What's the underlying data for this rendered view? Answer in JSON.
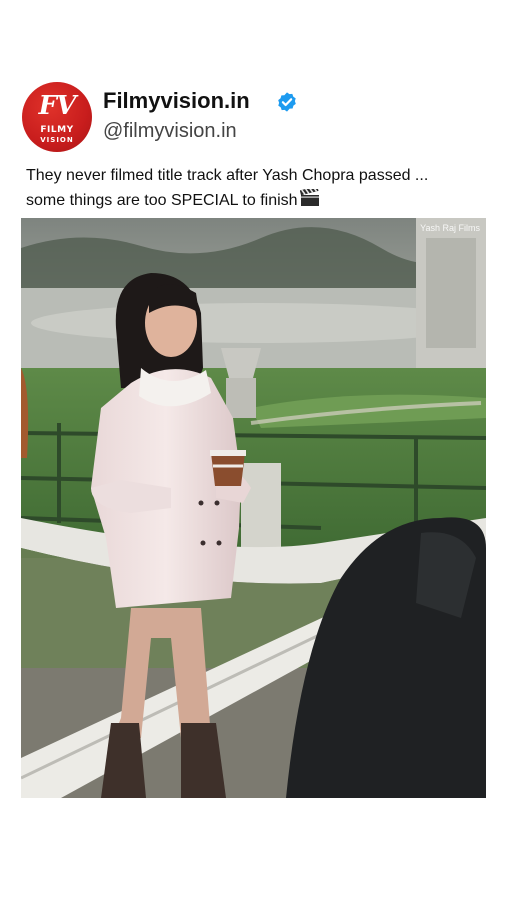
{
  "account": {
    "display_name": "Filmyvision.in",
    "handle": "@filmyvision.in",
    "avatar_logo": "FV",
    "avatar_text_1": "FILMY",
    "avatar_text_2": "VISION",
    "verified": true
  },
  "post": {
    "caption_line_1": "They never filmed title track after Yash Chopra passed ...",
    "caption_line_2": "some things are too SPECIAL to finish",
    "caption_emoji": "clapper-board-icon"
  },
  "media": {
    "watermark": "Yash Raj Films"
  },
  "colors": {
    "brand_red": "#c81d1d",
    "verified_blue": "#1d9bf0"
  }
}
